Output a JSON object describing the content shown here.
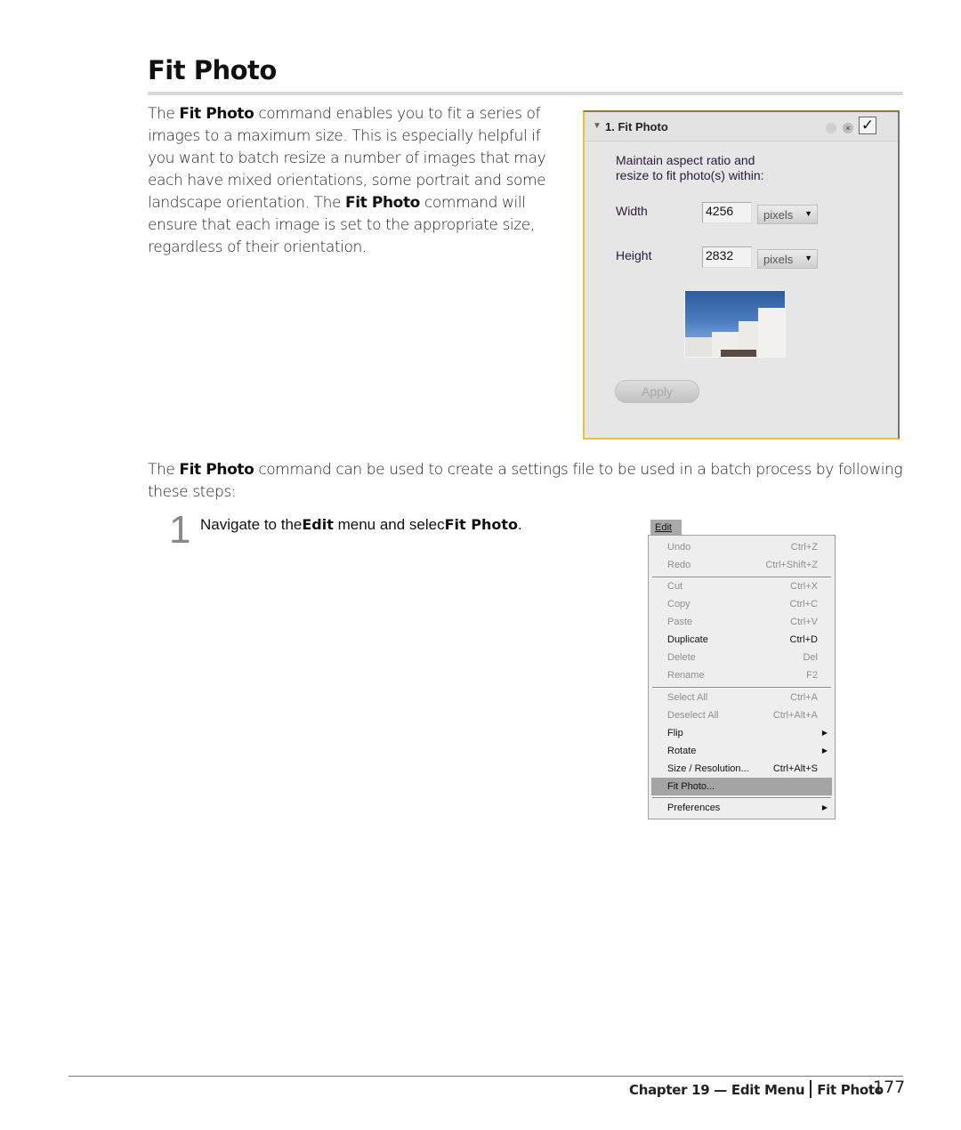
{
  "page": {
    "title": "Fit Photo",
    "intro": {
      "pre": "The ",
      "bold1": "Fit Photo",
      "mid": " command enables you to fit a series of images to a maximum size. This is especially helpful if you want to batch resize a number of images that may each have mixed orientations, some portrait and some landscape orientation. The ",
      "bold2": "Fit Photo",
      "post": " command will ensure that each image is set to the appropriate size, regardless of their orientation."
    },
    "para2": {
      "pre": "The ",
      "bold": "Fit Photo",
      "post": " command can be used to create a settings file to be used in a batch process by following these steps:"
    },
    "step": {
      "number": "1",
      "pre": "Navigate to the",
      "bold1": "Edit",
      "mid": " menu and selec",
      "bold2": "Fit Photo",
      "post": "."
    }
  },
  "panel": {
    "title": "1. Fit Photo",
    "reset_icon": "reset-icon",
    "close_icon": "close-icon",
    "enabled_check": "✓",
    "description_line1": "Maintain aspect ratio and",
    "description_line2": "resize to fit photo(s) within:",
    "width_label": "Width",
    "width_value": "4256",
    "width_unit": "pixels",
    "height_label": "Height",
    "height_value": "2832",
    "height_unit": "pixels",
    "apply_label": "Apply",
    "accent_color": "#e8c530"
  },
  "menu": {
    "title": "Edit",
    "items": [
      {
        "label": "Undo",
        "shortcut": "Ctrl+Z",
        "state": "disabled"
      },
      {
        "label": "Redo",
        "shortcut": "Ctrl+Shift+Z",
        "state": "disabled"
      },
      {
        "label": "Cut",
        "shortcut": "Ctrl+X",
        "state": "disabled"
      },
      {
        "label": "Copy",
        "shortcut": "Ctrl+C",
        "state": "disabled"
      },
      {
        "label": "Paste",
        "shortcut": "Ctrl+V",
        "state": "disabled"
      },
      {
        "label": "Duplicate",
        "shortcut": "Ctrl+D",
        "state": "enabled"
      },
      {
        "label": "Delete",
        "shortcut": "Del",
        "state": "disabled"
      },
      {
        "label": "Rename",
        "shortcut": "F2",
        "state": "disabled"
      },
      {
        "label": "Select All",
        "shortcut": "Ctrl+A",
        "state": "disabled"
      },
      {
        "label": "Deselect All",
        "shortcut": "Ctrl+Alt+A",
        "state": "disabled"
      },
      {
        "label": "Flip",
        "shortcut": "",
        "submenu": true,
        "state": "enabled"
      },
      {
        "label": "Rotate",
        "shortcut": "",
        "submenu": true,
        "state": "enabled"
      },
      {
        "label": "Size / Resolution...",
        "shortcut": "Ctrl+Alt+S",
        "state": "enabled"
      },
      {
        "label": "Fit Photo...",
        "shortcut": "",
        "state": "highlighted"
      },
      {
        "label": "Preferences",
        "shortcut": "",
        "submenu": true,
        "state": "enabled"
      }
    ]
  },
  "footer": {
    "chapter": "Chapter 19 — Edit Menu",
    "section": "Fit Photo",
    "page_number": "177"
  }
}
